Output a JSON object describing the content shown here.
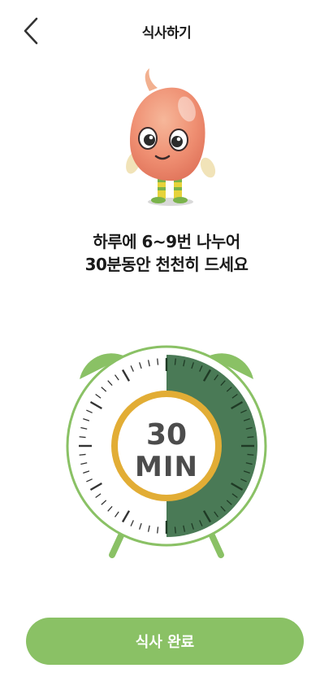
{
  "header": {
    "title": "식사하기",
    "back_icon": "chevron-left-icon"
  },
  "mascot": {
    "icon": "bean-character-mascot"
  },
  "message": {
    "line1": "하루에 6~9번 나누어",
    "line2": "30분동안 천천히 드세요"
  },
  "timer": {
    "value": "30",
    "unit": "MIN",
    "progress_fraction": 0.5,
    "colors": {
      "accent_green": "#8ac165",
      "dark_green": "#4a7a56",
      "ring_gold": "#e2ad35"
    }
  },
  "footer": {
    "complete_label": "식사 완료"
  }
}
